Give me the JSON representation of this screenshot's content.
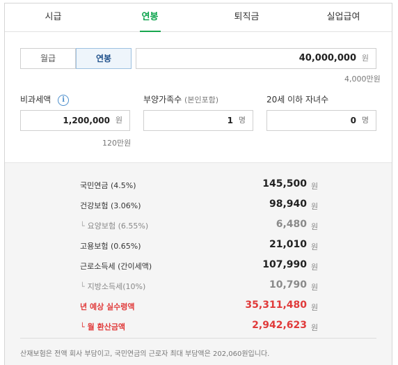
{
  "tabs": [
    "시급",
    "연봉",
    "퇴직금",
    "실업급여"
  ],
  "pay_type": {
    "monthly": "월급",
    "annual": "연봉"
  },
  "salary": {
    "value": "40,000,000",
    "unit": "원",
    "hint": "4,000만원"
  },
  "tax_free": {
    "label": "비과세액",
    "value": "1,200,000",
    "unit": "원",
    "hint": "120만원"
  },
  "dependents": {
    "label": "부양가족수",
    "label_sub": "(본인포함)",
    "value": "1",
    "unit": "명"
  },
  "children": {
    "label": "20세 이하 자녀수",
    "value": "0",
    "unit": "명"
  },
  "results": [
    {
      "name": "국민연금 (4.5%)",
      "amount": "145,500",
      "unit": "원",
      "style": "normal",
      "indent": false
    },
    {
      "name": "건강보험 (3.06%)",
      "amount": "98,940",
      "unit": "원",
      "style": "normal",
      "indent": false
    },
    {
      "name": "요양보험 (6.55%)",
      "amount": "6,480",
      "unit": "원",
      "style": "muted",
      "indent": true
    },
    {
      "name": "고용보험 (0.65%)",
      "amount": "21,010",
      "unit": "원",
      "style": "normal",
      "indent": false
    },
    {
      "name": "근로소득세 (간이세액)",
      "amount": "107,990",
      "unit": "원",
      "style": "normal",
      "indent": false
    },
    {
      "name": "지방소득세(10%)",
      "amount": "10,790",
      "unit": "원",
      "style": "muted",
      "indent": true
    },
    {
      "name": "년 예상 실수령액",
      "amount": "35,311,480",
      "unit": "원",
      "style": "red",
      "indent": false
    },
    {
      "name": "월 환산금액",
      "amount": "2,942,623",
      "unit": "원",
      "style": "red",
      "indent": true
    }
  ],
  "note": "산재보험은 전액 회사 부담이고, 국민연금의 근로자 최대 부담액은 202,060원입니다.",
  "colors": {
    "accent": "#0aa34b",
    "highlight": "#e03a3a"
  }
}
